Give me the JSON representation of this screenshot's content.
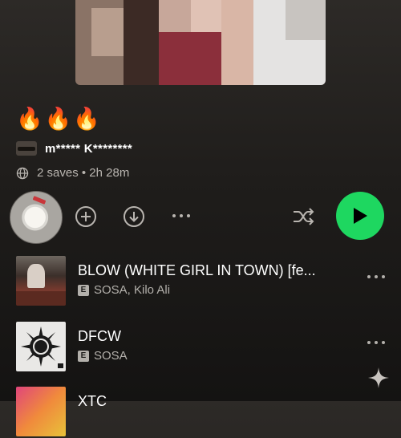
{
  "playlist": {
    "description": "🔥🔥🔥",
    "owner": "m***** K********",
    "meta": "2 saves • 2h 28m"
  },
  "icons": {
    "globe": "globe-icon",
    "add": "add-circle-icon",
    "download": "download-icon",
    "more": "more-dots-icon",
    "shuffle": "shuffle-icon",
    "play": "play-icon",
    "sparkle": "sparkle-icon"
  },
  "colors": {
    "accent": "#1ed760",
    "background": "#1f1d1b",
    "muted_text": "#b3b0ab"
  },
  "tracks": [
    {
      "title": "BLOW (WHITE GIRL IN TOWN) [fe...",
      "artists": "SOSA, Kilo Ali",
      "explicit": "E"
    },
    {
      "title": "DFCW",
      "artists": "SOSA",
      "explicit": "E"
    },
    {
      "title": "XTC",
      "artists": "",
      "explicit": ""
    }
  ]
}
